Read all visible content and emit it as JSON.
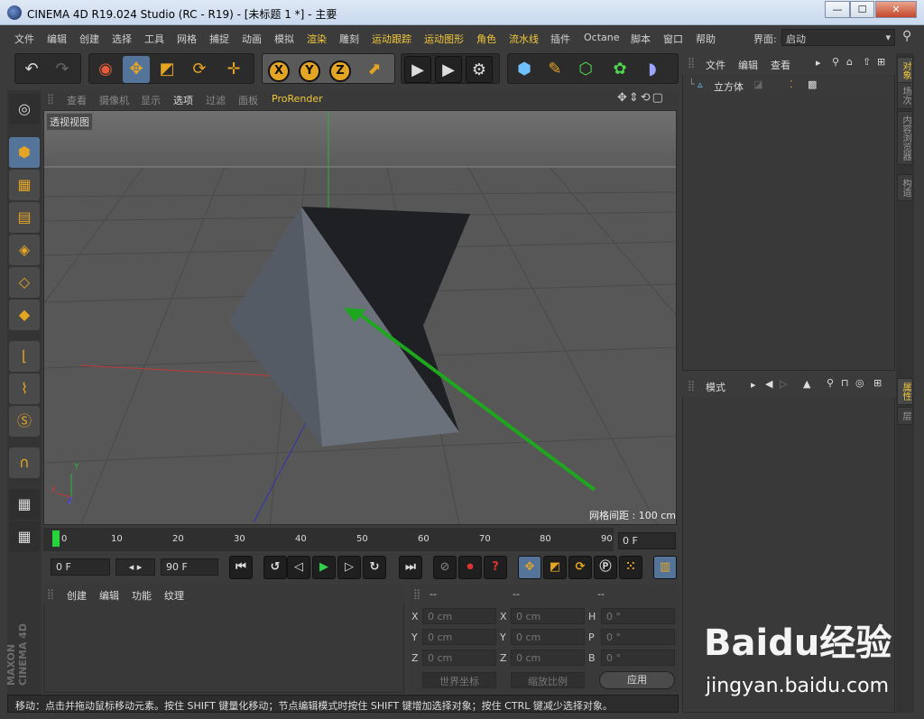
{
  "window": {
    "title": "CINEMA 4D R19.024 Studio (RC - R19) - [未标题 1 *] - 主要",
    "min": "—",
    "max": "☐",
    "close": "✕"
  },
  "menu": {
    "items": [
      "文件",
      "编辑",
      "创建",
      "选择",
      "工具",
      "网格",
      "捕捉",
      "动画",
      "模拟",
      "渲染",
      "雕刻",
      "运动跟踪",
      "运动图形",
      "角色",
      "流水线",
      "插件",
      "Octane",
      "脚本",
      "窗口",
      "帮助"
    ],
    "layout_label": "界面:",
    "layout_value": "启动"
  },
  "viewport": {
    "menu": [
      "查看",
      "摄像机",
      "显示",
      "选项",
      "过滤",
      "面板",
      "ProRender"
    ],
    "view_name": "透视视图",
    "grid_spacing": "网格间距 : 100 cm",
    "axis_x": "X",
    "axis_y": "Y",
    "axis_z": "Z"
  },
  "timeline": {
    "ticks": [
      "0",
      "10",
      "20",
      "30",
      "40",
      "50",
      "60",
      "70",
      "80",
      "90"
    ],
    "current_frame": "0 F",
    "start": "0 F",
    "end": "90 F"
  },
  "materials": {
    "menu": [
      "创建",
      "编辑",
      "功能",
      "纹理"
    ]
  },
  "coordinates": {
    "headers": [
      "--",
      "--",
      "--"
    ],
    "rows": [
      {
        "l1": "X",
        "v1": "0 cm",
        "l2": "X",
        "v2": "0 cm",
        "l3": "H",
        "v3": "0 °"
      },
      {
        "l1": "Y",
        "v1": "0 cm",
        "l2": "Y",
        "v2": "0 cm",
        "l3": "P",
        "v3": "0 °"
      },
      {
        "l1": "Z",
        "v1": "0 cm",
        "l2": "Z",
        "v2": "0 cm",
        "l3": "B",
        "v3": "0 °"
      }
    ],
    "world_coords": "世界坐标",
    "scale_ratio": "缩放比例",
    "apply": "应用"
  },
  "status": "移动：点击并拖动鼠标移动元素。按住 SHIFT 键量化移动；节点编辑模式时按住 SHIFT 键增加选择对象；按住 CTRL 键减少选择对象。",
  "objects": {
    "menu": [
      "文件",
      "编辑",
      "查看"
    ],
    "item": "立方体"
  },
  "attributes": {
    "menu": "模式"
  },
  "side_tabs": [
    "对象",
    "场次",
    "内容浏览器",
    "构造",
    "属性",
    "层"
  ],
  "branding": {
    "maxon": "MAXON",
    "cinema": "CINEMA 4D",
    "watermark": "Baidu经验",
    "url": "jingyan.baidu.com"
  }
}
